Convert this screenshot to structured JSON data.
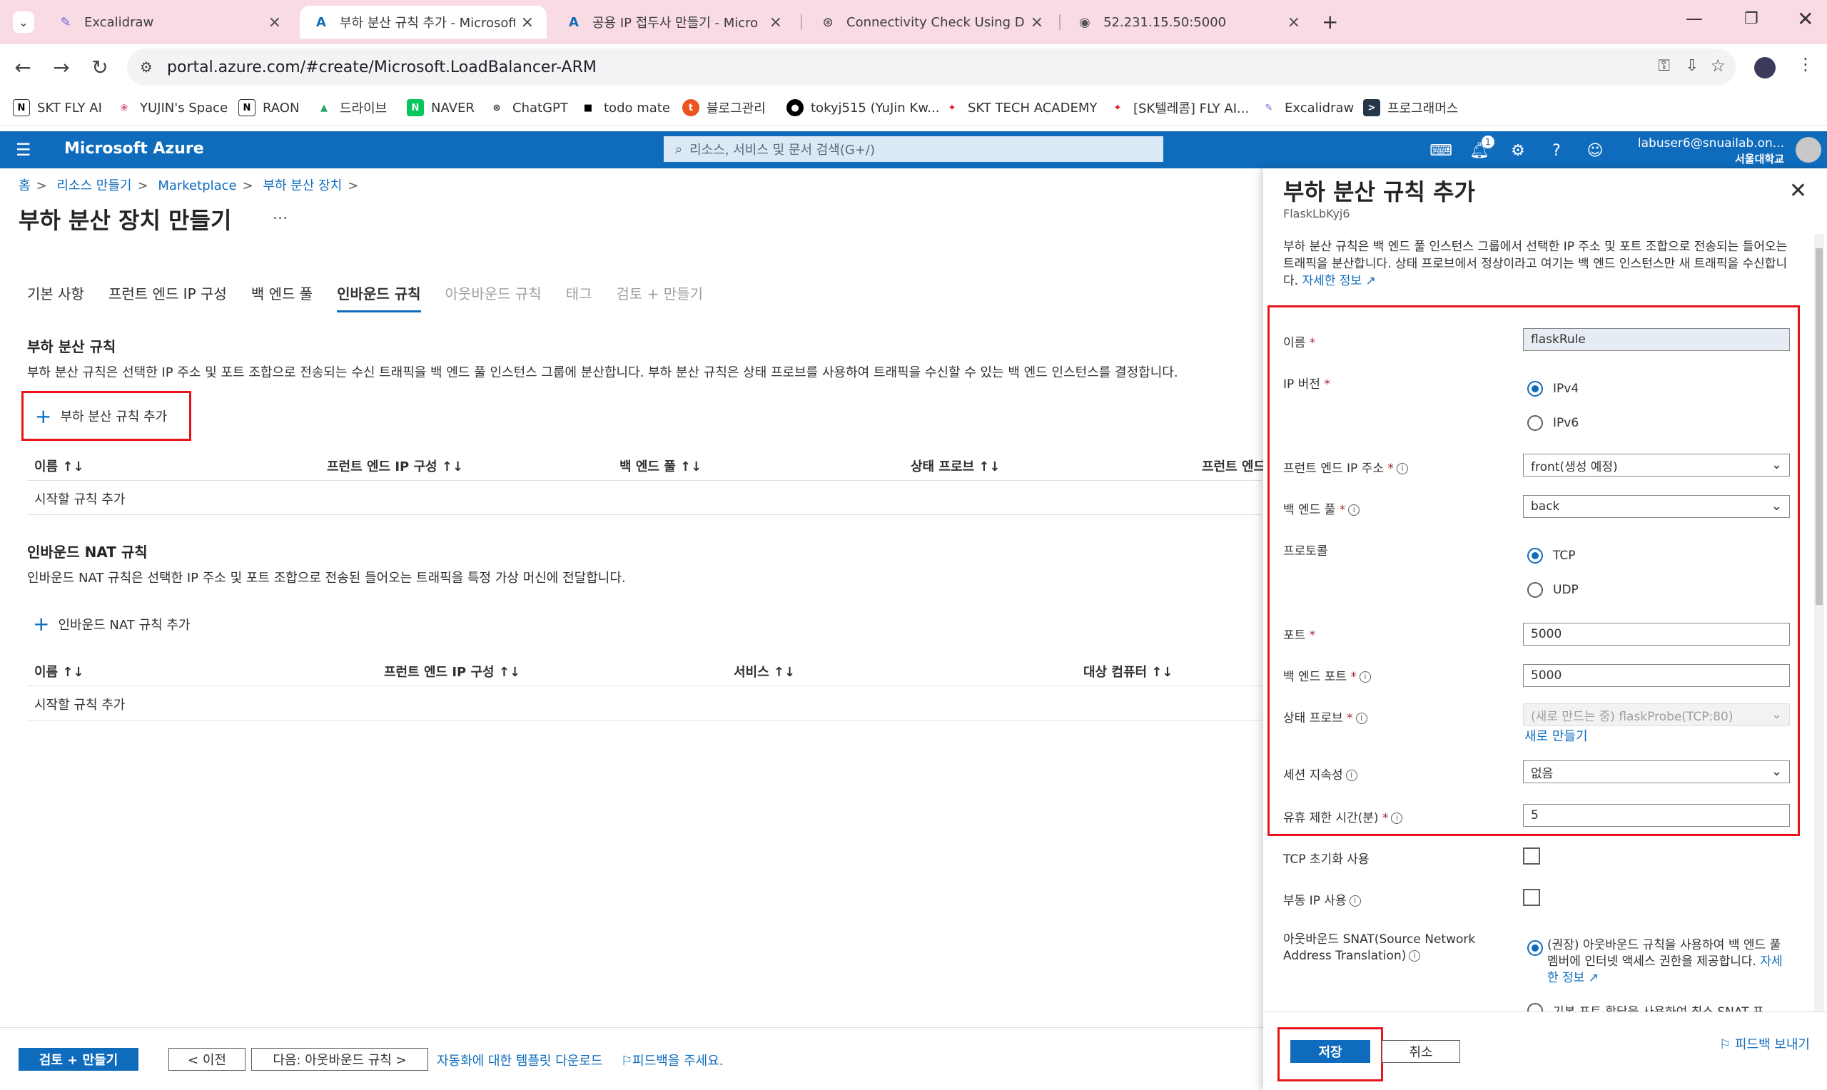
{
  "browser": {
    "tabs": [
      {
        "title": "Excalidraw",
        "icon": "excalidraw-icon"
      },
      {
        "title": "부하 분산 규칙 추가 - Microsoft",
        "icon": "azure-icon",
        "active": true
      },
      {
        "title": "공용 IP 접두사 만들기 - Micro",
        "icon": "azure-icon"
      },
      {
        "title": "Connectivity Check Using DFS",
        "icon": "openai-icon"
      },
      {
        "title": "52.231.15.50:5000",
        "icon": "globe-icon"
      }
    ],
    "url": "portal.azure.com/#create/Microsoft.LoadBalancer-ARM",
    "bookmarks": [
      "SKT FLY AI",
      "YUJIN's Space",
      "RAON",
      "드라이브",
      "NAVER",
      "ChatGPT",
      "todo mate",
      "블로그관리",
      "tokyj515 (YuJin Kw...",
      "SKT TECH ACADEMY",
      "[SK텔레콤] FLY AI...",
      "Excalidraw",
      "프로그래머스"
    ]
  },
  "azure": {
    "brand": "Microsoft Azure",
    "search_placeholder": "리소스, 서비스 및 문서 검색(G+/)",
    "notification_count": "1",
    "user_email": "labuser6@snuailab.on...",
    "user_org": "서울대학교"
  },
  "breadcrumb": [
    "홈",
    "리소스 만들기",
    "Marketplace",
    "부하 분산 장치"
  ],
  "page_title": "부하 분산 장치 만들기",
  "page_title_more": "...",
  "wizard_tabs": [
    {
      "label": "기본 사항",
      "state": "normal"
    },
    {
      "label": "프런트 엔드 IP 구성",
      "state": "normal"
    },
    {
      "label": "백 엔드 풀",
      "state": "normal"
    },
    {
      "label": "인바운드 규칙",
      "state": "active"
    },
    {
      "label": "아웃바운드 규칙",
      "state": "disabled"
    },
    {
      "label": "태그",
      "state": "disabled"
    },
    {
      "label": "검토 + 만들기",
      "state": "disabled"
    }
  ],
  "lb_rules": {
    "title": "부하 분산 규칙",
    "desc": "부하 분산 규칙은 선택한 IP 주소 및 포트 조합으로 전송되는 수신 트래픽을 백 엔드 풀 인스턴스 그룹에 분산합니다. 부하 분산 규칙은 상태 프로브를 사용하여 트래픽을 수신할 수 있는 백 엔드 인스턴스를 결정합니다.",
    "add_label": "부하 분산 규칙 추가",
    "columns": [
      "이름 ↑↓",
      "프런트 엔드 IP 구성 ↑↓",
      "백 엔드 풀 ↑↓",
      "상태 프로브 ↑↓",
      "프런트 엔드"
    ],
    "empty": "시작할 규칙 추가"
  },
  "nat_rules": {
    "title": "인바운드 NAT 규칙",
    "desc": "인바운드 NAT 규칙은 선택한 IP 주소 및 포트 조합으로 전송된 들어오는 트래픽을 특정 가상 머신에 전달합니다.",
    "add_label": "인바운드 NAT 규칙 추가",
    "columns": [
      "이름 ↑↓",
      "프런트 엔드 IP 구성 ↑↓",
      "서비스 ↑↓",
      "대상 컴퓨터 ↑↓"
    ],
    "empty": "시작할 규칙 추가"
  },
  "footer": {
    "review_create": "검토 + 만들기",
    "prev": "< 이전",
    "next": "다음: 아웃바운드 규칙 >",
    "template_link": "자동화에 대한 템플릿 다운로드",
    "feedback": "피드백을 주세요."
  },
  "panel": {
    "title": "부하 분산 규칙 추가",
    "subtitle": "FlaskLbKyj6",
    "desc": "부하 분산 규칙은 백 엔드 풀 인스턴스 그룹에서 선택한 IP 주소 및 포트 조합으로 전송되는 들어오는 트래픽을 분산합니다. 상태 프로브에서 정상이라고 여기는 백 엔드 인스턴스만 새 트래픽을 수신합니다.",
    "desc_link": "자세한 정보",
    "fields": {
      "name_label": "이름",
      "name_value": "flaskRule",
      "ipver_label": "IP 버전",
      "ipv4": "IPv4",
      "ipv6": "IPv6",
      "frontend_label": "프런트 엔드 IP 주소",
      "frontend_value": "front(생성 예정)",
      "backend_label": "백 엔드 풀",
      "backend_value": "back",
      "protocol_label": "프로토콜",
      "tcp": "TCP",
      "udp": "UDP",
      "port_label": "포트",
      "port_value": "5000",
      "backend_port_label": "백 엔드 포트",
      "backend_port_value": "5000",
      "probe_label": "상태 프로브",
      "probe_value": "(새로 만드는 중) flaskProbe(TCP:80)",
      "probe_new": "새로 만들기",
      "session_label": "세션 지속성",
      "session_value": "없음",
      "idle_label": "유휴 제한 시간(분)",
      "idle_value": "5",
      "tcp_reset_label": "TCP 초기화 사용",
      "floating_label": "부동 IP 사용",
      "snat_label": "아웃바운드 SNAT(Source Network Address Translation)",
      "snat_option1": "(권장) 아웃바운드 규칙을 사용하여 백 엔드 풀 멤버에 인터넷 액세스 권한을 제공합니다.",
      "snat_option1_link": "자세한 정보",
      "snat_option2": "기본 포트 할당을 사용하여 최소 SNAT 포"
    },
    "save": "저장",
    "cancel": "취소",
    "feedback": "피드백 보내기"
  },
  "colors": {
    "azure_blue": "#0f6cbd",
    "highlight_red": "#e8141a",
    "tab_strip": "#f9dbe3"
  }
}
